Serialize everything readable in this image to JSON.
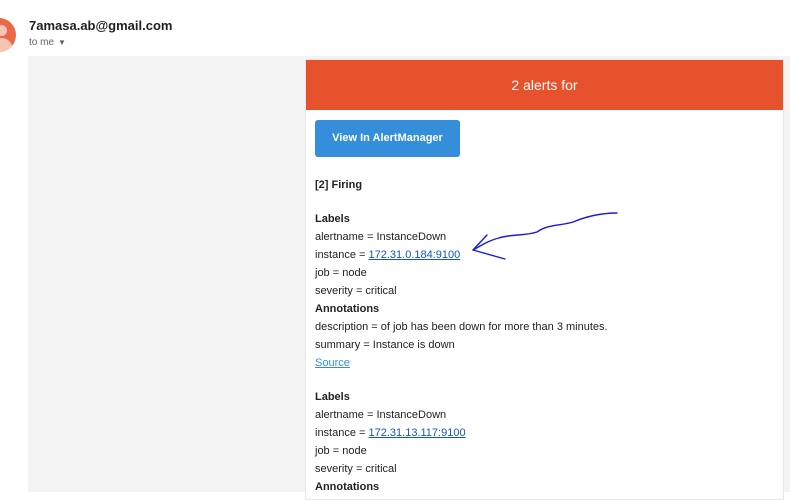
{
  "header": {
    "sender": "7amasa.ab@gmail.com",
    "recipient": "to me",
    "recipient_caret_icon": "caret-down-icon"
  },
  "email": {
    "banner_title": "2 alerts for",
    "button_label": "View In AlertManager",
    "firing_title": "[2] Firing",
    "alerts": [
      {
        "labels_heading": "Labels",
        "alertname": "alertname = InstanceDown",
        "instance_prefix": "instance = ",
        "instance_link": "172.31.0.184:9100",
        "job": "job = node",
        "severity": "severity = critical",
        "annotations_heading": "Annotations",
        "description": "description = of job has been down for more than 3 minutes.",
        "summary": "summary = Instance is down",
        "source_link": "Source"
      },
      {
        "labels_heading": "Labels",
        "alertname": "alertname = InstanceDown",
        "instance_prefix": "instance = ",
        "instance_link": "172.31.13.117:9100",
        "job": "job = node",
        "severity": "severity = critical",
        "annotations_heading": "Annotations"
      }
    ]
  },
  "colors": {
    "banner": "#e6522c",
    "button": "#348eda",
    "link": "#1155cc",
    "annotation_ink": "#1a1adf",
    "avatar": "#ea6a47"
  }
}
